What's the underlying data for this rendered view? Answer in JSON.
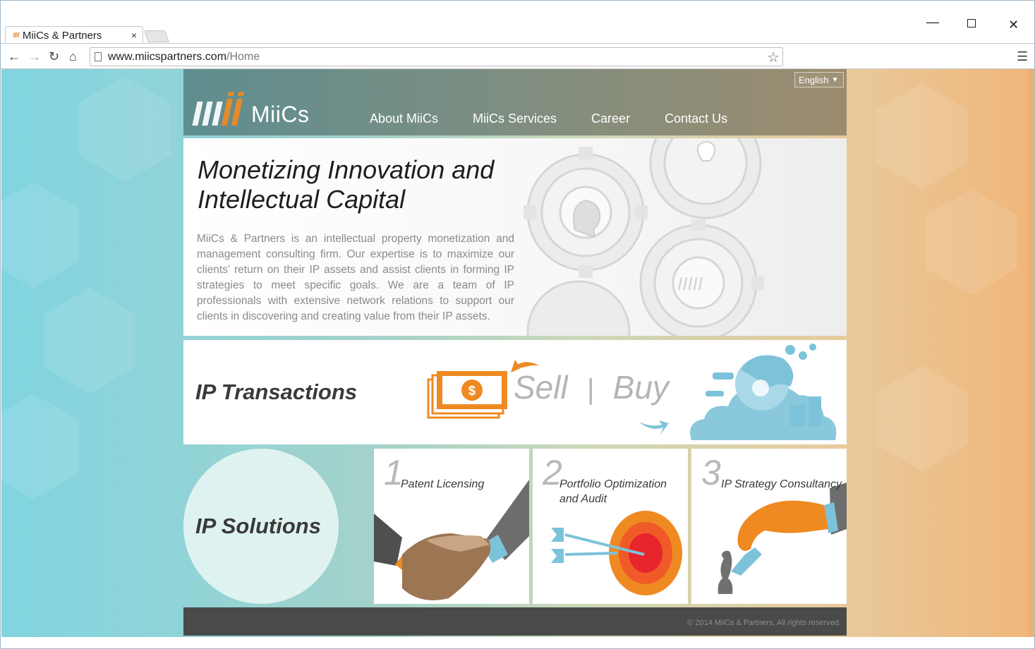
{
  "browser": {
    "tab_title": "MiiCs & Partners",
    "tab_close": "×",
    "favicon": "IIIII",
    "url_host": "www.miicspartners.com",
    "url_path": "/Home",
    "window_minimize": "—",
    "window_close": "✕"
  },
  "header": {
    "language": "English",
    "logo_text": "MiiCs",
    "nav": [
      "About MiiCs",
      "MiiCs Services",
      "Career",
      "Contact Us"
    ]
  },
  "hero": {
    "title": "Monetizing Innovation and Intellectual Capital",
    "body": "MiiCs & Partners is an intellectual property monetization and management consulting firm. Our expertise is to maximize our clients’ return on their IP assets and assist clients in forming IP strategies to meet specific goals. We are a team of IP professionals with extensive network relations to support our clients in discovering and creating value from their IP assets."
  },
  "transactions": {
    "title": "IP Transactions",
    "sell": "Sell",
    "divider": "|",
    "buy": "Buy",
    "currency": "$"
  },
  "solutions": {
    "title": "IP Solutions",
    "cards": [
      {
        "num": "1",
        "label": "Patent Licensing"
      },
      {
        "num": "2",
        "label": "Portfolio Optimization and Audit"
      },
      {
        "num": "3",
        "label": "IP Strategy Consultancy"
      }
    ]
  },
  "footer": {
    "copyright": "© 2014 MiiCs & Partners, All rights reserved."
  },
  "colors": {
    "accent_orange": "#ef8a23",
    "accent_blue": "#7cc3d9",
    "footer_bg": "#4a4a4a"
  },
  "icons": [
    "back-icon",
    "forward-icon",
    "reload-icon",
    "home-icon",
    "page-icon",
    "star-icon",
    "menu-icon",
    "dropdown-caret-icon"
  ]
}
